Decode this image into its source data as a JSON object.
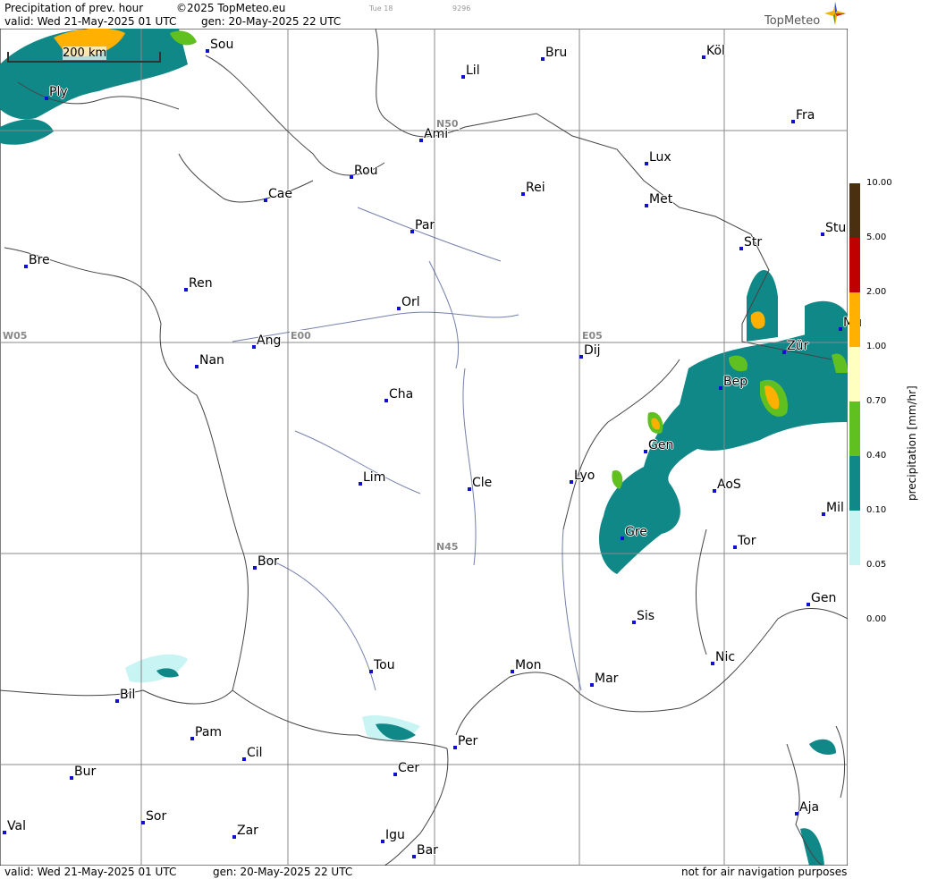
{
  "header": {
    "title": "Precipitation of prev. hour",
    "copyright": "©2025 TopMeteo.eu",
    "valid": "valid:  Wed  21-May-2025  01 UTC",
    "gen": "gen: 20-May-2025 22 UTC",
    "faint_day": "Tue 18",
    "faint_code": "9296",
    "brand": "TopMeteo"
  },
  "footer": {
    "valid": "valid:  Wed  21-May-2025  01 UTC",
    "gen": "gen: 20-May-2025 22 UTC",
    "disclaimer": "not for air navigation purposes"
  },
  "map": {
    "scale_label": "200 km",
    "grid_labels": [
      "N50",
      "N45",
      "W05",
      "E00",
      "E05"
    ],
    "cities": [
      {
        "name": "Sou"
      },
      {
        "name": "Köl"
      },
      {
        "name": "Bru"
      },
      {
        "name": "Lil"
      },
      {
        "name": "Ply"
      },
      {
        "name": "Ami"
      },
      {
        "name": "Fra"
      },
      {
        "name": "Rou"
      },
      {
        "name": "Lux"
      },
      {
        "name": "Cae"
      },
      {
        "name": "Rei"
      },
      {
        "name": "Met"
      },
      {
        "name": "Par"
      },
      {
        "name": "Stu"
      },
      {
        "name": "Bre"
      },
      {
        "name": "Str"
      },
      {
        "name": "Ren"
      },
      {
        "name": "Orl"
      },
      {
        "name": "Mü"
      },
      {
        "name": "Ang"
      },
      {
        "name": "Dij"
      },
      {
        "name": "Zür"
      },
      {
        "name": "Nan"
      },
      {
        "name": "Bер"
      },
      {
        "name": "Cha"
      },
      {
        "name": "Gen"
      },
      {
        "name": "Lim"
      },
      {
        "name": "Cle"
      },
      {
        "name": "Lyo"
      },
      {
        "name": "AoS"
      },
      {
        "name": "Mil"
      },
      {
        "name": "Gre"
      },
      {
        "name": "Tor"
      },
      {
        "name": "Bor"
      },
      {
        "name": "Gen"
      },
      {
        "name": "Sis"
      },
      {
        "name": "Tou"
      },
      {
        "name": "Nic"
      },
      {
        "name": "Bil"
      },
      {
        "name": "Mon"
      },
      {
        "name": "Mar"
      },
      {
        "name": "Pam"
      },
      {
        "name": "Per"
      },
      {
        "name": "Cil"
      },
      {
        "name": "Bur"
      },
      {
        "name": "Cer"
      },
      {
        "name": "Sor"
      },
      {
        "name": "Aja"
      },
      {
        "name": "Val"
      },
      {
        "name": "Zar"
      },
      {
        "name": "Igu"
      },
      {
        "name": "Bar"
      }
    ]
  },
  "legend": {
    "label": "precipitation [mm/hr]",
    "ticks": [
      "10.00",
      "5.00",
      "2.00",
      "1.00",
      "0.70",
      "0.40",
      "0.10",
      "0.05",
      "0.00"
    ],
    "colors": [
      "#4a3010",
      "#c00000",
      "#ff6a00",
      "#ffb000",
      "#ffffc0",
      "#60c020",
      "#118888",
      "#c8f4f4",
      "#ffffff"
    ]
  }
}
